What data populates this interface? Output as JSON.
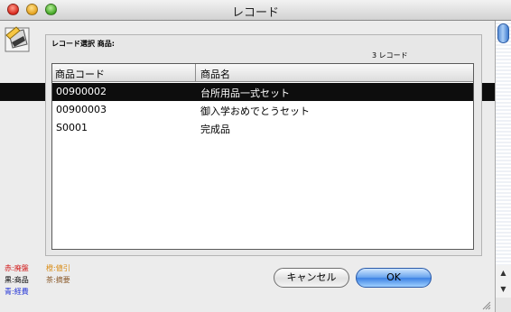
{
  "window": {
    "title": "レコード"
  },
  "dialog": {
    "group_label": "レコード選択 商品:",
    "record_count": "3 レコード",
    "columns": [
      "商品コード",
      "商品名"
    ],
    "rows": [
      {
        "code": "00900002",
        "name": "台所用品一式セット",
        "selected": true
      },
      {
        "code": "00900003",
        "name": "御入学おめでとうセット",
        "selected": false
      },
      {
        "code": "S0001",
        "name": "完成品",
        "selected": false
      }
    ],
    "cancel_label": "キャンセル",
    "ok_label": "OK"
  },
  "legend": [
    {
      "text": "赤:廃盤",
      "color": "#d21b1b"
    },
    {
      "text": "橙:値引",
      "color": "#d98a12"
    },
    {
      "text": "黒:商品",
      "color": "#000000"
    },
    {
      "text": "茶:摘要",
      "color": "#8a5a2b"
    },
    {
      "text": "青:経費",
      "color": "#1e2fd6"
    }
  ],
  "colors": {
    "selection": "#0d0d0d",
    "accent": "#3d82e4"
  }
}
